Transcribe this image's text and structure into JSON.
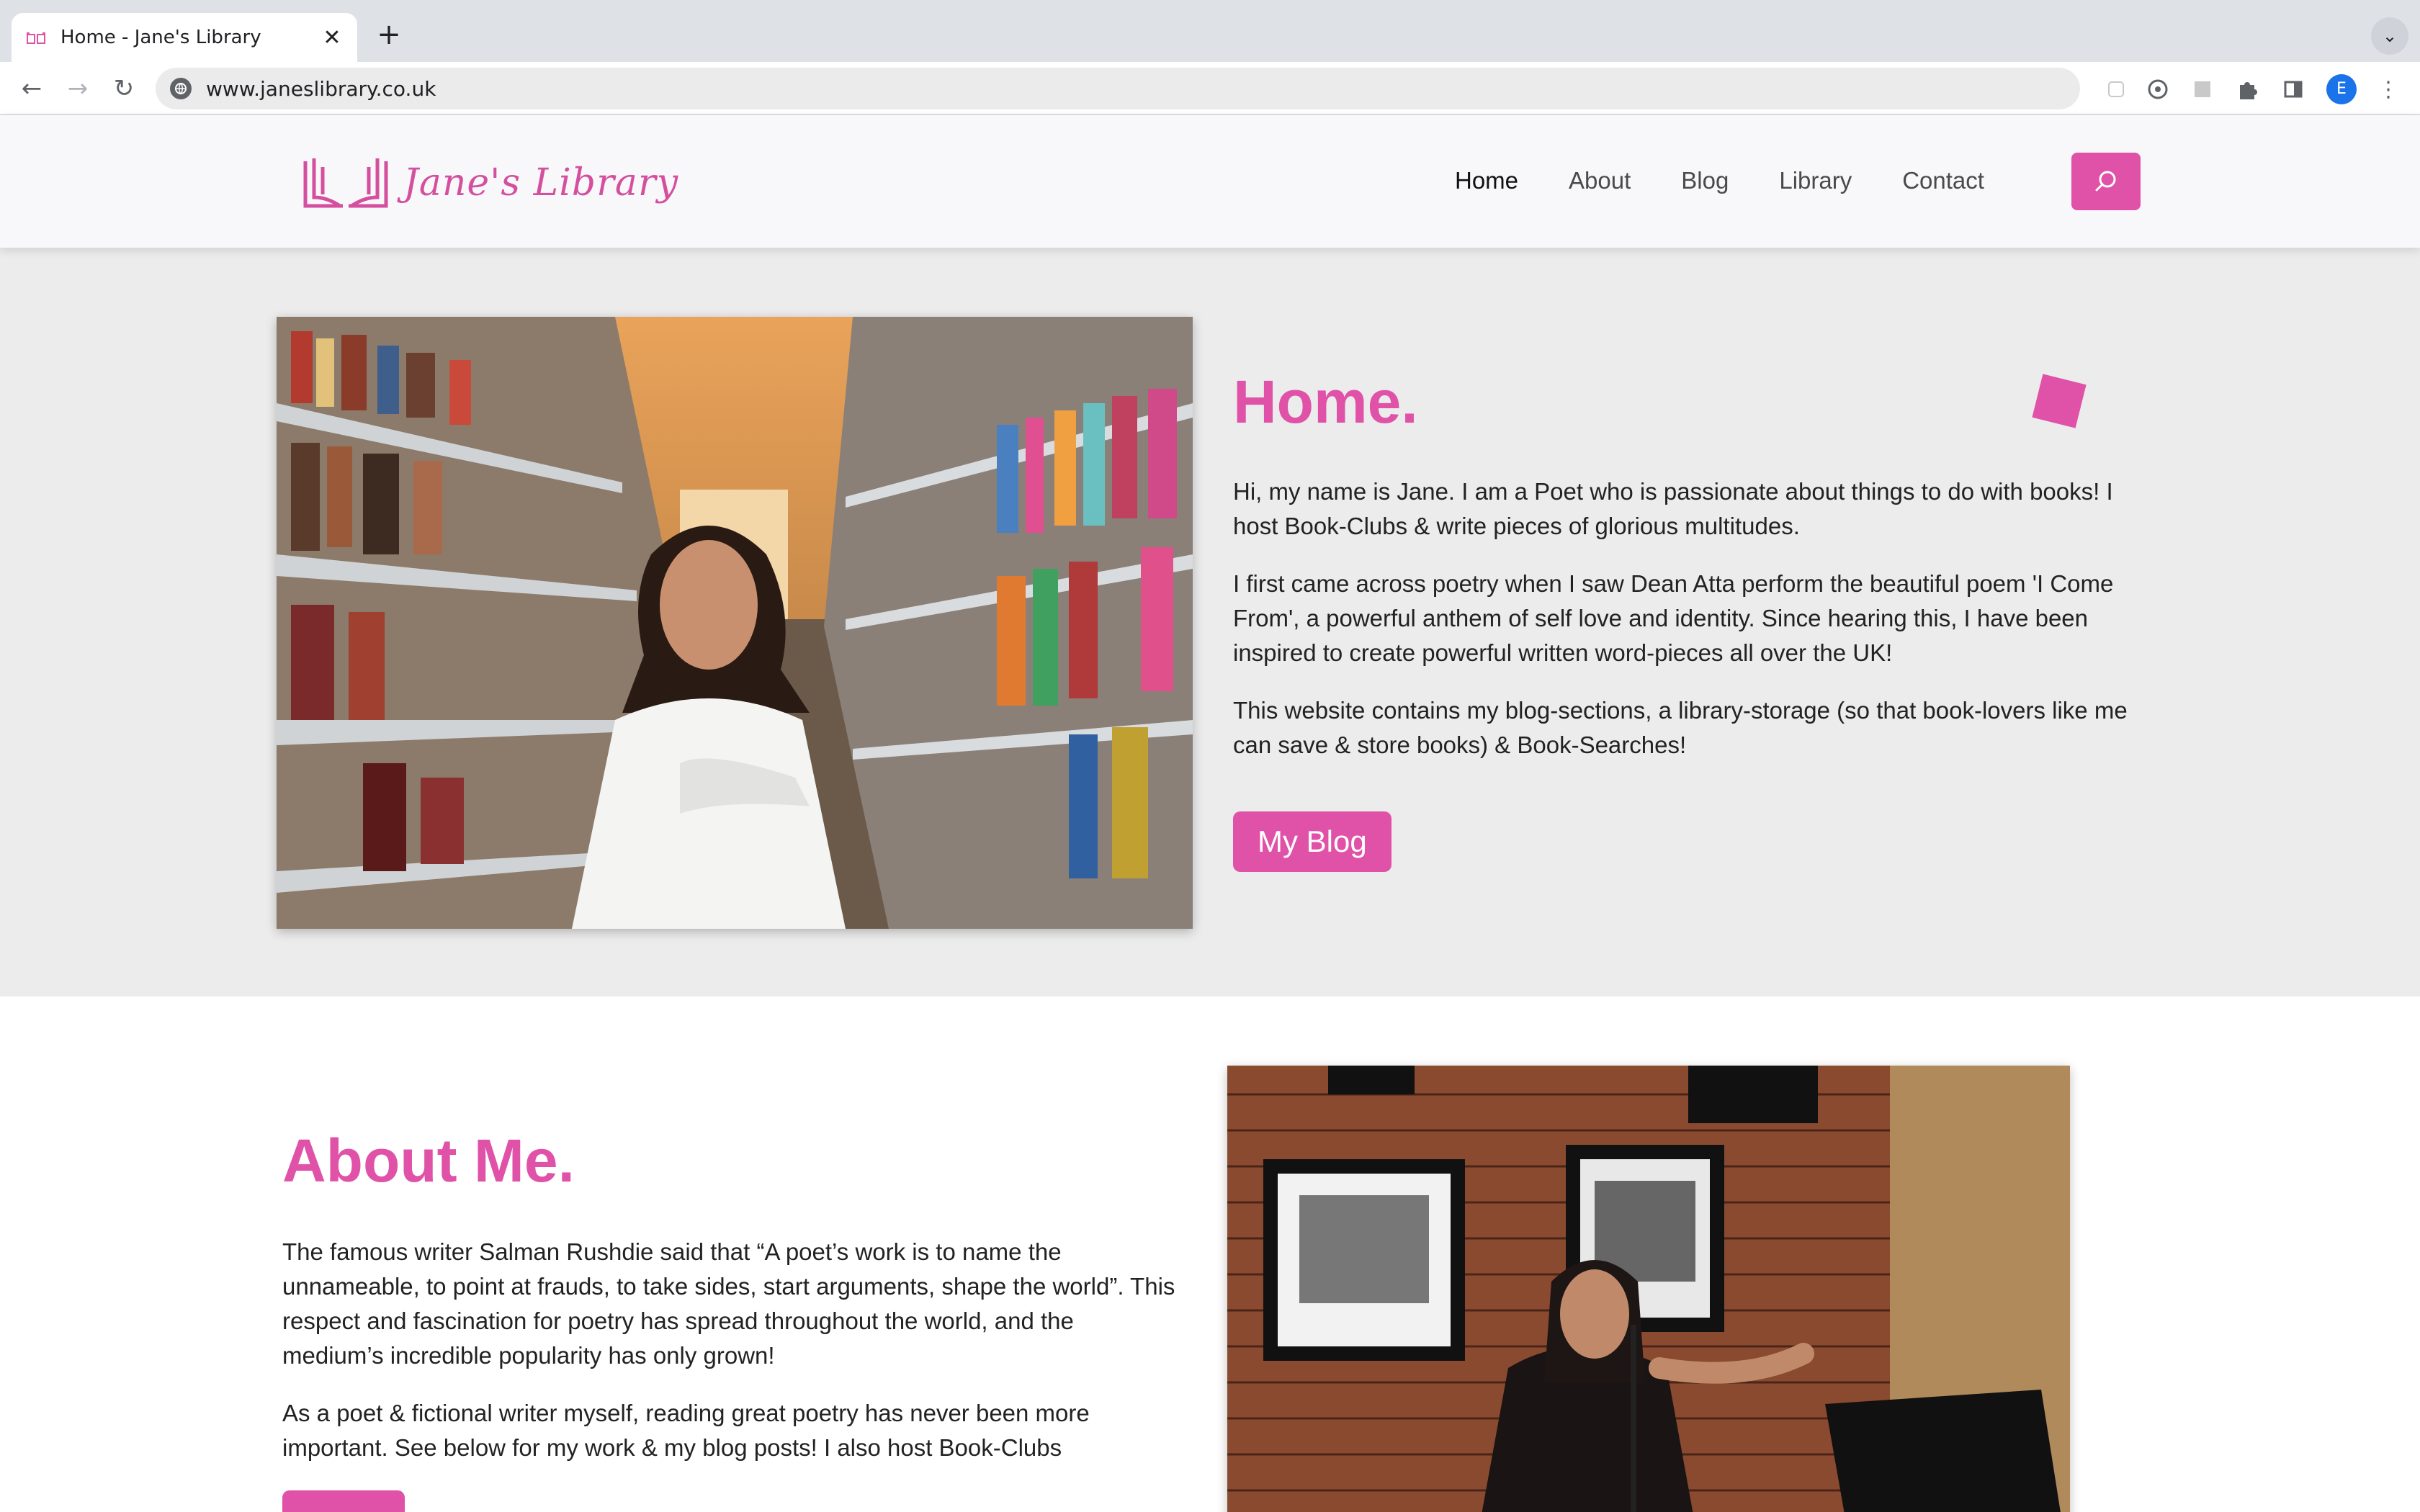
{
  "browser": {
    "tab_title": "Home - Jane's Library",
    "url": "www.janeslibrary.co.uk",
    "profile_initial": "E"
  },
  "site": {
    "logo_text": "Jane's Library",
    "nav": [
      {
        "label": "Home",
        "active": true
      },
      {
        "label": "About",
        "active": false
      },
      {
        "label": "Blog",
        "active": false
      },
      {
        "label": "Library",
        "active": false
      },
      {
        "label": "Contact",
        "active": false
      }
    ],
    "accent_color": "#e052a8"
  },
  "home": {
    "title": "Home.",
    "paragraphs": [
      "Hi, my name is Jane. I am a Poet who is passionate about things to do with books! I host Book-Clubs & write pieces of glorious multitudes.",
      "I first came across poetry when I saw Dean Atta perform the beautiful poem 'I Come From', a powerful anthem of self love and identity. Since hearing this, I have been inspired to create powerful written word-pieces all over the UK!",
      "This website contains my blog-sections, a library-storage (so that book-lovers like me can save & store books) & Book-Searches!"
    ],
    "button_label": "My Blog"
  },
  "about": {
    "title": "About Me.",
    "paragraphs": [
      "The famous writer Salman Rushdie said that “A poet’s work is to name the unnameable, to point at frauds, to take sides, start arguments, shape the world”. This respect and fascination for poetry has spread throughout the world, and the medium’s incredible popularity has only grown!",
      "As a poet & fictional writer myself, reading great poetry has never been more important. See below for my work & my blog posts! I also host Book-Clubs"
    ]
  }
}
